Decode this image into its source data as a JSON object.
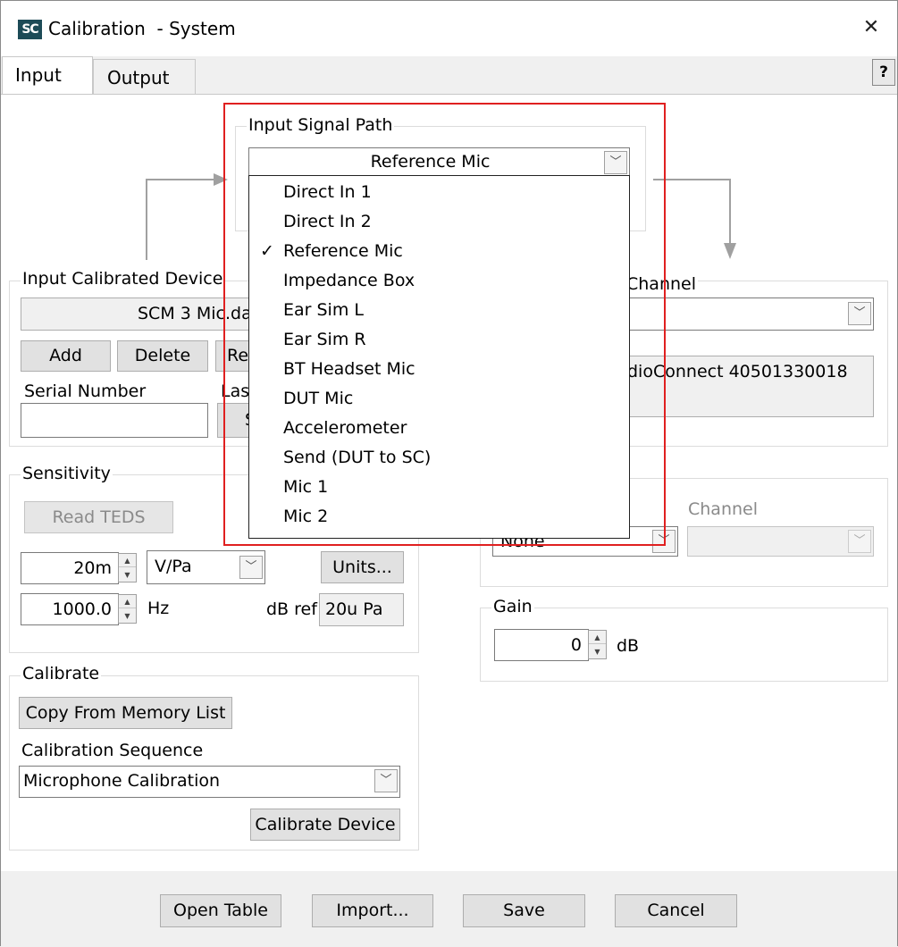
{
  "window": {
    "icon_text": "SC",
    "title": "Calibration  - System"
  },
  "tabs": [
    {
      "label": "Input",
      "active": true
    },
    {
      "label": "Output",
      "active": false
    }
  ],
  "help_label": "?",
  "input_signal_path": {
    "label": "Input Signal Path",
    "selected": "Reference Mic",
    "options": [
      "Direct In 1",
      "Direct In 2",
      "Reference Mic",
      "Impedance Box",
      "Ear Sim L",
      "Ear Sim R",
      "BT Headset Mic",
      "DUT Mic",
      "Accelerometer",
      "Send (DUT to SC)",
      "Mic 1",
      "Mic 2"
    ],
    "checked_index": 2
  },
  "input_calibrated_device": {
    "label": "Input Calibrated Device",
    "file_value": "SCM 3 Mic.da",
    "add_label": "Add",
    "delete_label": "Delete",
    "rename_label": "Re",
    "serial_label": "Serial Number",
    "serial_value": "",
    "last_label": "Las",
    "last_button": "S"
  },
  "channel_group": {
    "label": "Channel",
    "dropdown_value": "",
    "device_text": "dioConnect 40501330018"
  },
  "sensitivity": {
    "label": "Sensitivity",
    "read_teds_label": "Read TEDS",
    "value": "20m",
    "unit": "V/Pa",
    "units_button": "Units...",
    "freq_value": "1000.0",
    "freq_unit": "Hz",
    "db_ref_label": "dB ref",
    "db_ref_value": "20u Pa"
  },
  "aux_group": {
    "device_value": "None",
    "channel_label": "Channel",
    "channel_value": ""
  },
  "gain": {
    "label": "Gain",
    "value": "0",
    "unit": "dB"
  },
  "calibrate": {
    "label": "Calibrate",
    "copy_button": "Copy From Memory List",
    "sequence_label": "Calibration Sequence",
    "sequence_value": "Microphone Calibration",
    "calibrate_button": "Calibrate Device"
  },
  "footer": {
    "open_table": "Open Table",
    "import": "Import...",
    "save": "Save",
    "cancel": "Cancel"
  },
  "icons": {
    "dropdown": "chevron-down-icon",
    "spin_up": "triangle-up-icon",
    "spin_down": "triangle-down-icon",
    "close": "close-icon",
    "check": "checkmark-icon"
  },
  "colors": {
    "highlight": "#e02020",
    "app_icon": "#1d4b57"
  }
}
